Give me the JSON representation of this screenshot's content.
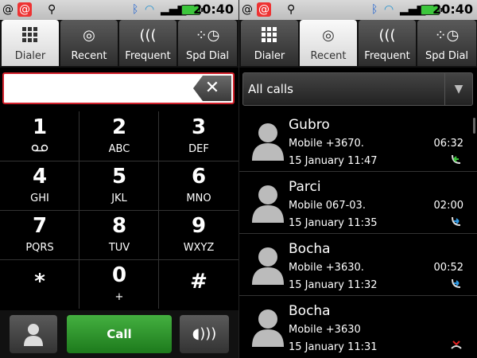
{
  "status": {
    "time": "20:40",
    "icons": [
      "at-icon",
      "email-icon",
      "usb-icon",
      "bluetooth-icon",
      "wifi-icon",
      "signal-icon",
      "battery-icon"
    ]
  },
  "tabs": [
    {
      "label": "Dialer",
      "icon": "dialpad-icon"
    },
    {
      "label": "Recent",
      "icon": "recent-calls-icon"
    },
    {
      "label": "Frequent",
      "icon": "frequent-icon"
    },
    {
      "label": "Spd Dial",
      "icon": "speed-dial-icon"
    }
  ],
  "dialer": {
    "input_value": "",
    "keys": [
      {
        "digit": "1",
        "letters": ""
      },
      {
        "digit": "2",
        "letters": "ABC"
      },
      {
        "digit": "3",
        "letters": "DEF"
      },
      {
        "digit": "4",
        "letters": "GHI"
      },
      {
        "digit": "5",
        "letters": "JKL"
      },
      {
        "digit": "6",
        "letters": "MNO"
      },
      {
        "digit": "7",
        "letters": "PQRS"
      },
      {
        "digit": "8",
        "letters": "TUV"
      },
      {
        "digit": "9",
        "letters": "WXYZ"
      },
      {
        "digit": "*",
        "letters": ""
      },
      {
        "digit": "0",
        "letters": "+"
      },
      {
        "digit": "#",
        "letters": ""
      }
    ],
    "call_label": "Call"
  },
  "recent": {
    "filter": "All calls",
    "calls": [
      {
        "name": "Gubro",
        "number": "Mobile +3670.",
        "date": "15 January 11:47",
        "duration": "06:32",
        "type": "outgoing",
        "type_color": "#3cc63c"
      },
      {
        "name": "Parci",
        "number": "Mobile 067-03.",
        "date": "15 January 11:35",
        "duration": "02:00",
        "type": "incoming",
        "type_color": "#2f9be6"
      },
      {
        "name": "Bocha",
        "number": "Mobile +3630.",
        "date": "15 January 11:32",
        "duration": "00:52",
        "type": "incoming",
        "type_color": "#2f9be6"
      },
      {
        "name": "Bocha",
        "number": "Mobile +3630",
        "date": "15 January 11:31",
        "duration": "",
        "type": "missed",
        "type_color": "#e02020"
      }
    ]
  }
}
